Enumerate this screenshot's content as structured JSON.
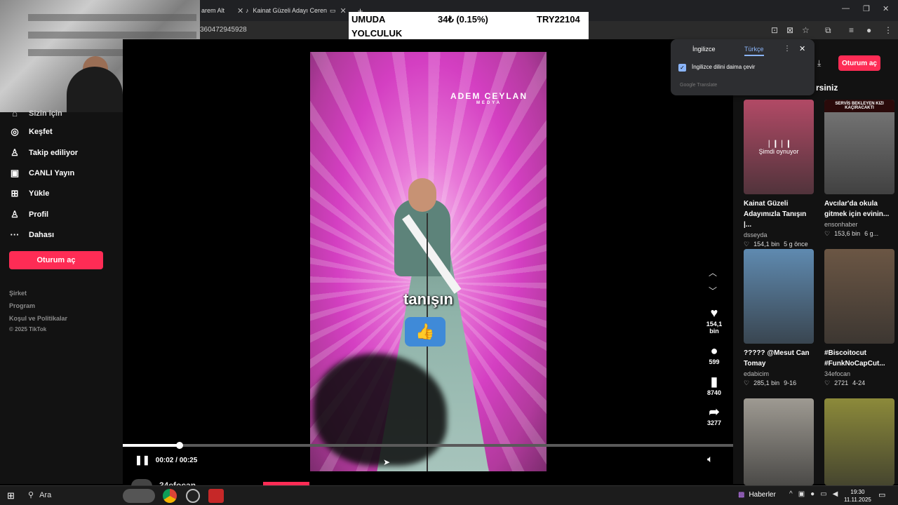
{
  "browser": {
    "tabs": [
      {
        "label": "arem Alt",
        "close": "✕"
      },
      {
        "label": "Kainat Güzeli Adayı Ceren",
        "close": "✕"
      }
    ],
    "new_tab": "+",
    "url": "360472945928"
  },
  "ticker": {
    "name_line1": "UMUDA",
    "name_line2": "YOLCULUK",
    "price": "34₺ (0.15%)",
    "code": "TRY22104"
  },
  "translate_popup": {
    "lang_from": "İngilizce",
    "lang_to": "Türkçe",
    "always_translate": "İngilizce dilini daima çevir",
    "brand": "Google Translate",
    "menu": "⋮",
    "close": "✕"
  },
  "sidebar": {
    "partial_item": "Sizin için",
    "items": [
      {
        "label": "Keşfet",
        "icon": "◎"
      },
      {
        "label": "Takip ediliyor",
        "icon": "♙"
      },
      {
        "label": "CANLI Yayın",
        "icon": "▣"
      },
      {
        "label": "Yükle",
        "icon": "⊞"
      },
      {
        "label": "Profil",
        "icon": "♙"
      },
      {
        "label": "Dahası",
        "icon": "···"
      }
    ],
    "login": "Oturum aç",
    "footer": [
      "Şirket",
      "Program",
      "Koşul ve Politikalar",
      "© 2025 TikTok"
    ]
  },
  "video": {
    "watermark": "ADEM CEYLAN",
    "watermark_sub": "MEDYA",
    "caption": "tanışın",
    "progress": 0.093,
    "time": "00:02 / 00:25",
    "author": "34efocan"
  },
  "actions": {
    "likes": "154,1 bin",
    "comments": "599",
    "saves": "8740",
    "shares": "3277"
  },
  "right": {
    "header": "rsiniz",
    "login": "Oturum aç",
    "cards": [
      {
        "title": "Kainat Güzeli Adayımızla Tanışın |...",
        "author": "dsseyda",
        "likes": "154,1 bin",
        "date": "5 g önce",
        "now_playing": "Şimdi oynuyor",
        "thumb_color": "#b24a66"
      },
      {
        "title": "Avcılar'da okula gitmek için evinin...",
        "author": "ensonhaber",
        "likes": "153,6 bin",
        "date": "6 g...",
        "banner": "SERVİS BEKLEYEN KIZI KAÇIRACAKTI",
        "thumb_color": "#7a7a7a"
      },
      {
        "title": "????? @Mesut Can Tomay",
        "author": "edabicim",
        "likes": "285,1 bin",
        "date": "9-16",
        "thumb_color": "#5f8ab0"
      },
      {
        "title": "#Biscoitocut #FunkNoCapCut...",
        "author": "34efocan",
        "likes": "2721",
        "date": "4-24",
        "thumb_color": "#6b5644"
      },
      {
        "title": "",
        "author": "",
        "likes": "",
        "date": "",
        "thumb_color": "#9e9a92"
      },
      {
        "title": "",
        "author": "",
        "likes": "",
        "date": "",
        "thumb_color": "#8c8a3a"
      }
    ]
  },
  "taskbar": {
    "search": "Ara",
    "news": "Haberler",
    "time": "19:30",
    "date": "11.11.2025"
  }
}
